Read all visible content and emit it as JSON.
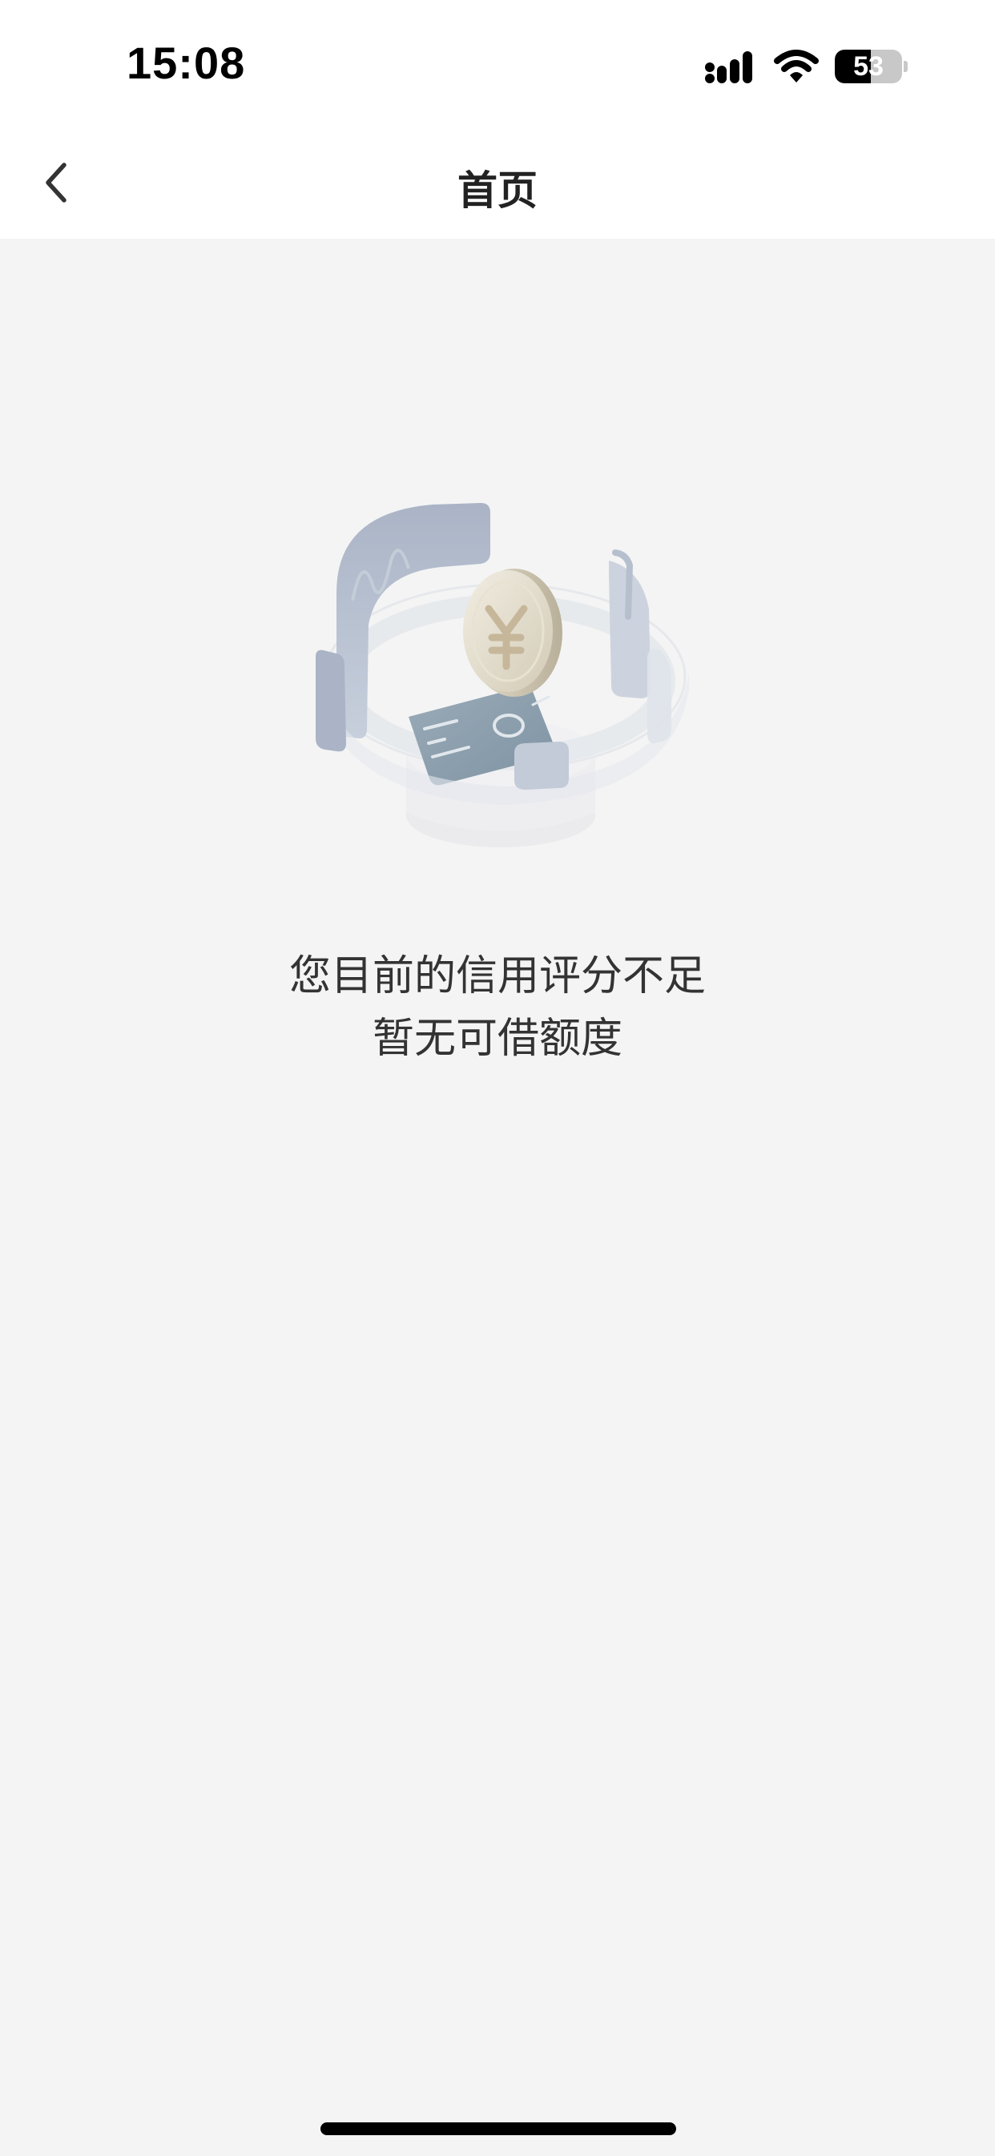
{
  "status_bar": {
    "time": "15:08",
    "battery_level": "53",
    "battery_fraction": 0.53,
    "icons": [
      "signal-icon",
      "wifi-icon",
      "battery-icon"
    ]
  },
  "nav": {
    "title": "首页",
    "back_icon": "chevron-left-icon"
  },
  "empty_state": {
    "illustration": "coin-card-illustration",
    "line1": "您目前的信用评分不足",
    "line2": "暂无可借额度"
  },
  "colors": {
    "background": "#f4f4f4",
    "nav_background": "#ffffff",
    "title_text": "#222222",
    "body_text": "#333333"
  }
}
